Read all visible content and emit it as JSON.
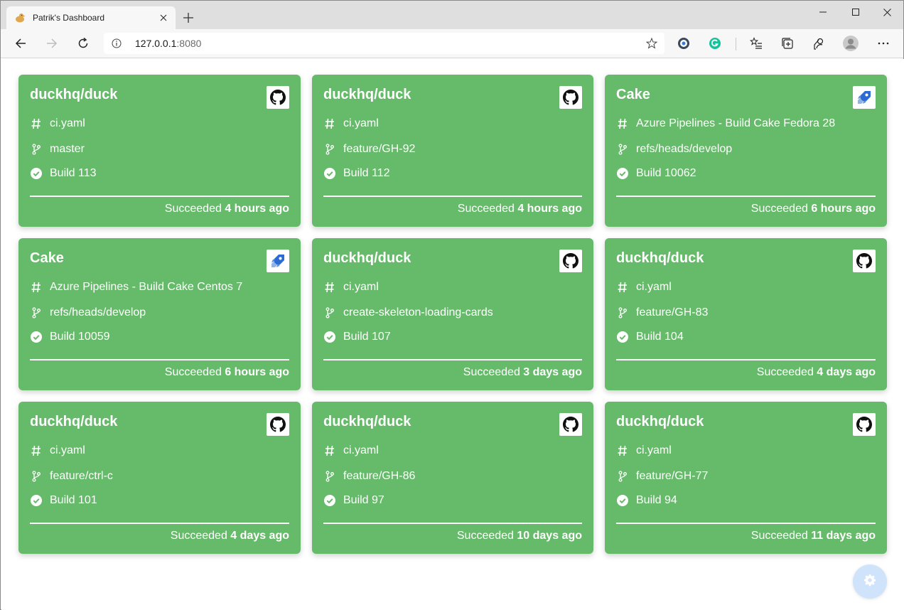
{
  "browser": {
    "tab_title": "Patrik's Dashboard",
    "url_host": "127.0.0.1",
    "url_port": ":8080"
  },
  "cards": [
    {
      "title": "duckhq/duck",
      "provider": "github-icon",
      "definition": "ci.yaml",
      "branch": "master",
      "build": "Build 113",
      "status": "Succeeded",
      "when": "4 hours ago"
    },
    {
      "title": "duckhq/duck",
      "provider": "github-icon",
      "definition": "ci.yaml",
      "branch": "feature/GH-92",
      "build": "Build 112",
      "status": "Succeeded",
      "when": "4 hours ago"
    },
    {
      "title": "Cake",
      "provider": "azure-pipelines-icon",
      "definition": "Azure Pipelines - Build Cake Fedora 28",
      "branch": "refs/heads/develop",
      "build": "Build 10062",
      "status": "Succeeded",
      "when": "6 hours ago"
    },
    {
      "title": "Cake",
      "provider": "azure-pipelines-icon",
      "definition": "Azure Pipelines - Build Cake Centos 7",
      "branch": "refs/heads/develop",
      "build": "Build 10059",
      "status": "Succeeded",
      "when": "6 hours ago"
    },
    {
      "title": "duckhq/duck",
      "provider": "github-icon",
      "definition": "ci.yaml",
      "branch": "create-skeleton-loading-cards",
      "build": "Build 107",
      "status": "Succeeded",
      "when": "3 days ago"
    },
    {
      "title": "duckhq/duck",
      "provider": "github-icon",
      "definition": "ci.yaml",
      "branch": "feature/GH-83",
      "build": "Build 104",
      "status": "Succeeded",
      "when": "4 days ago"
    },
    {
      "title": "duckhq/duck",
      "provider": "github-icon",
      "definition": "ci.yaml",
      "branch": "feature/ctrl-c",
      "build": "Build 101",
      "status": "Succeeded",
      "when": "4 days ago"
    },
    {
      "title": "duckhq/duck",
      "provider": "github-icon",
      "definition": "ci.yaml",
      "branch": "feature/GH-86",
      "build": "Build 97",
      "status": "Succeeded",
      "when": "10 days ago"
    },
    {
      "title": "duckhq/duck",
      "provider": "github-icon",
      "definition": "ci.yaml",
      "branch": "feature/GH-77",
      "build": "Build 94",
      "status": "Succeeded",
      "when": "11 days ago"
    }
  ],
  "colors": {
    "success_card": "#66bb6a",
    "settings_fab": "#cfe3fb"
  }
}
